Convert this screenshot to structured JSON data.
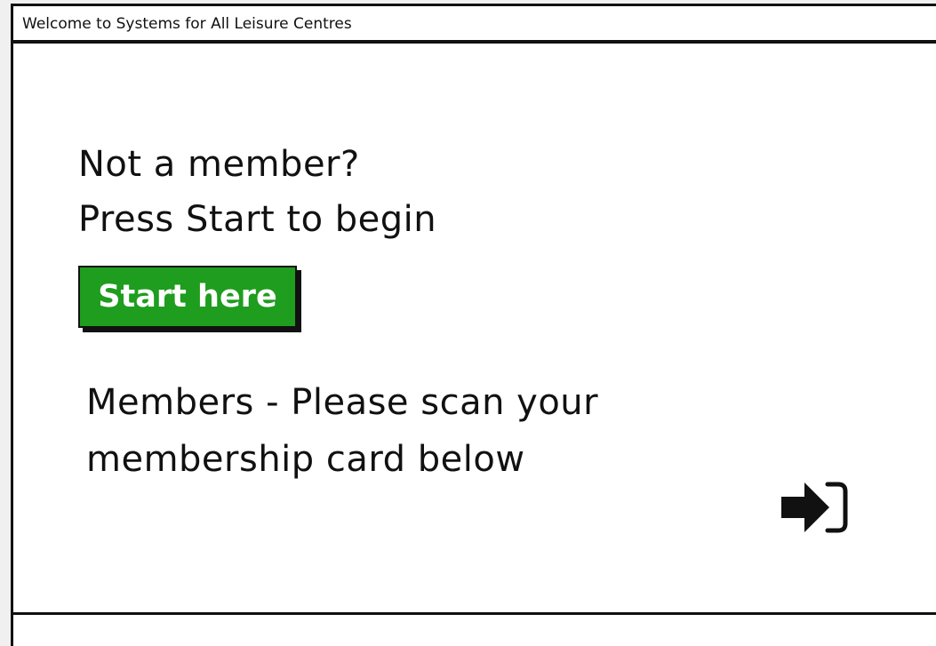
{
  "window": {
    "title": "Welcome to Systems for All Leisure Centres"
  },
  "main": {
    "prompt_line1": "Not a member?",
    "prompt_line2": "Press Start to begin",
    "start_button_label": "Start here",
    "members_line1": "Members - Please scan your",
    "members_line2": "membership card below",
    "scan_icon": "sign-in-icon"
  },
  "colors": {
    "start_button_bg": "#1e9d1e",
    "start_button_text": "#ffffff",
    "border": "#111111"
  }
}
